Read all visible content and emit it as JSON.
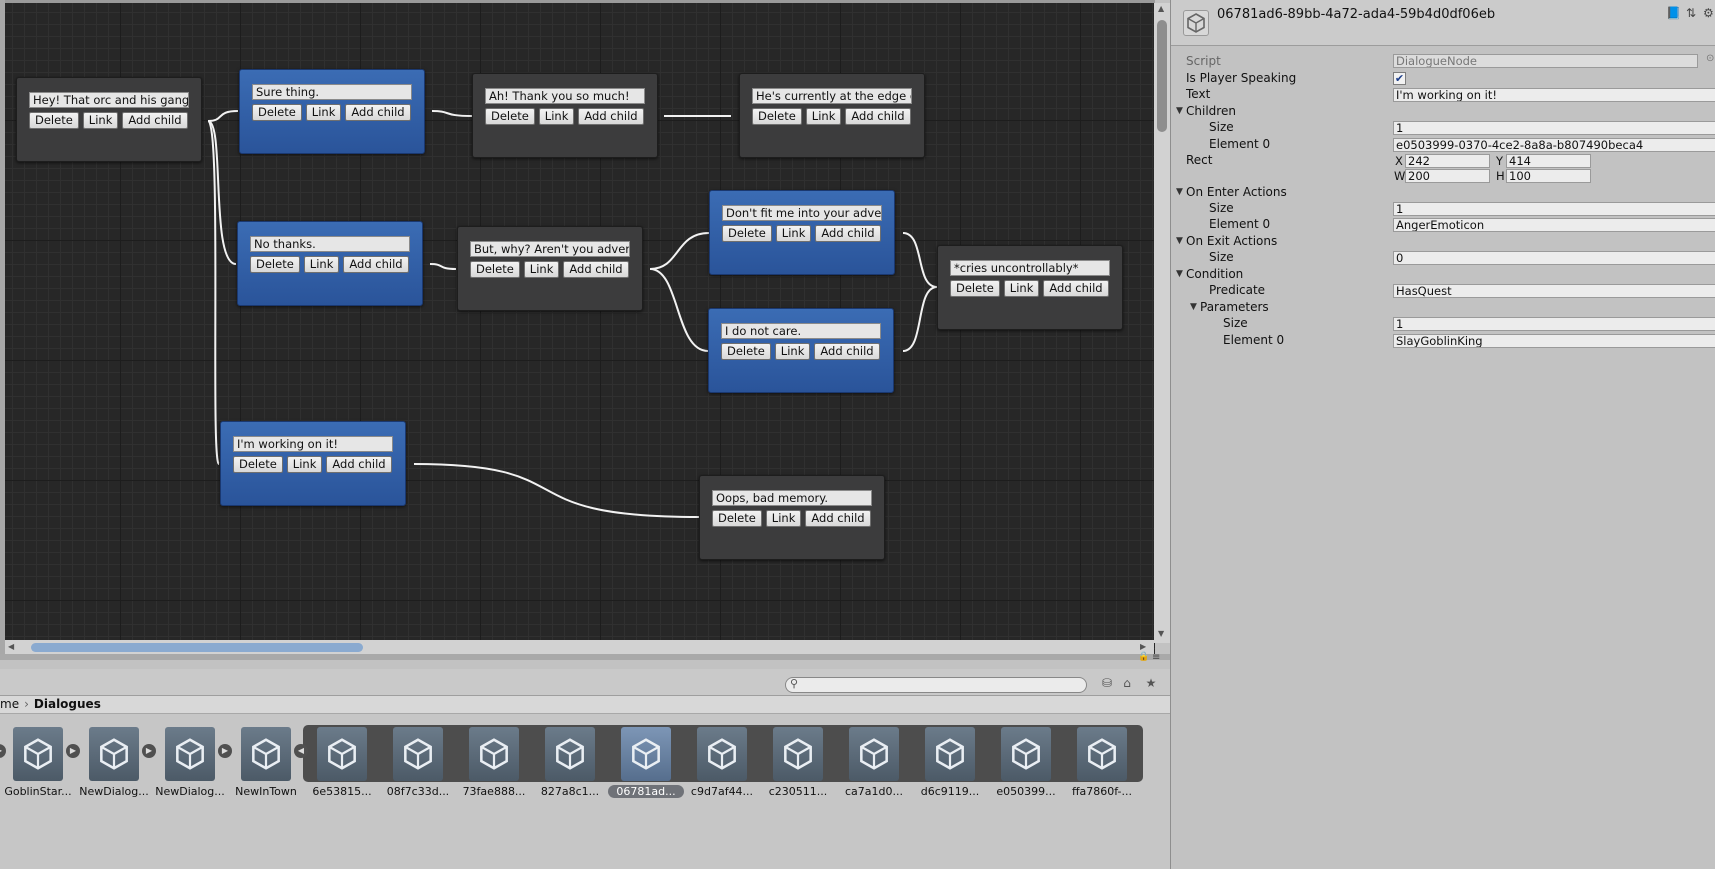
{
  "graph": {
    "nodes": [
      {
        "text": "Hey! That orc and his gang"
      },
      {
        "text": "Sure thing."
      },
      {
        "text": "Ah! Thank you so much!"
      },
      {
        "text": "He's currently at the edge o"
      },
      {
        "text": "No thanks."
      },
      {
        "text": "But, why? Aren't you adver"
      },
      {
        "text": "Don't fit me into your adve"
      },
      {
        "text": "I do not care."
      },
      {
        "text": "*cries uncontrollably*"
      },
      {
        "text": "I'm working on it!"
      },
      {
        "text": "Oops, bad memory."
      }
    ],
    "buttons": {
      "delete": "Delete",
      "link": "Link",
      "add_child": "Add child"
    }
  },
  "breadcrumb": {
    "parent": "me",
    "current": "Dialogues"
  },
  "assets": [
    {
      "label": "GoblinStar..."
    },
    {
      "label": "NewDialog..."
    },
    {
      "label": "NewDialog..."
    },
    {
      "label": "NewInTown"
    },
    {
      "label": "6e53815..."
    },
    {
      "label": "08f7c33d..."
    },
    {
      "label": "73fae888..."
    },
    {
      "label": "827a8c1..."
    },
    {
      "label": "06781ad..."
    },
    {
      "label": "c9d7af44..."
    },
    {
      "label": "c230511..."
    },
    {
      "label": "ca7a1d0..."
    },
    {
      "label": "d6c9119..."
    },
    {
      "label": "e050399..."
    },
    {
      "label": "ffa7860f-..."
    }
  ],
  "inspector": {
    "title": "06781ad6-89bb-4a72-ada4-59b4d0df06eb",
    "script_label": "Script",
    "script_value": "DialogueNode",
    "is_player_speaking_label": "Is Player Speaking",
    "is_player_speaking": true,
    "text_label": "Text",
    "text_value": "I'm working on it!",
    "children_label": "Children",
    "size_label": "Size",
    "children_size": "1",
    "element0_label": "Element 0",
    "children_element0": "e0503999-0370-4ce2-8a8a-b807490beca4",
    "rect_label": "Rect",
    "rect_x_label": "X",
    "rect_x": "242",
    "rect_y_label": "Y",
    "rect_y": "414",
    "rect_w_label": "W",
    "rect_w": "200",
    "rect_h_label": "H",
    "rect_h": "100",
    "on_enter_label": "On Enter Actions",
    "on_enter_size": "1",
    "on_enter_element0": "AngerEmoticon",
    "on_exit_label": "On Exit Actions",
    "on_exit_size": "0",
    "condition_label": "Condition",
    "predicate_label": "Predicate",
    "predicate_value": "HasQuest",
    "parameters_label": "Parameters",
    "parameters_size": "1",
    "parameters_element0": "SlayGoblinKing"
  },
  "colors": {
    "node_gray": "#3c3c3d",
    "node_blue": "#2f5ea6",
    "graph_bg": "#272727",
    "inspector_bg": "#c2c2c2"
  }
}
